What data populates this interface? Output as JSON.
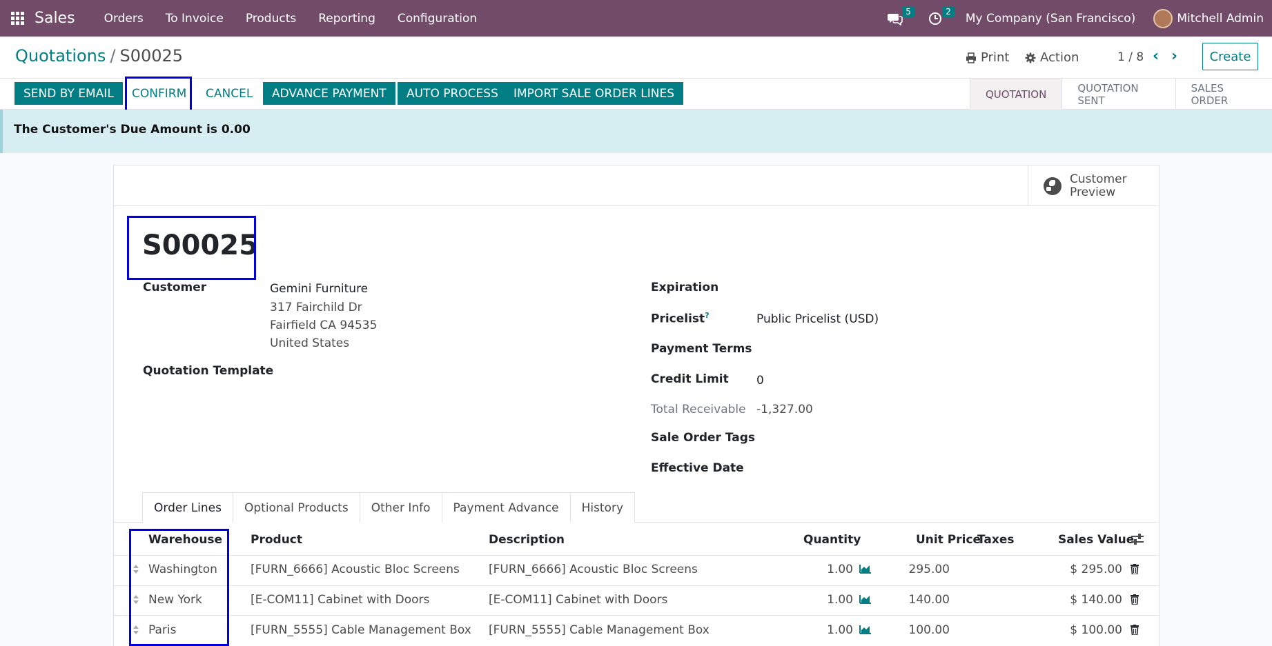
{
  "navbar": {
    "app_name": "Sales",
    "menu": [
      "Orders",
      "To Invoice",
      "Products",
      "Reporting",
      "Configuration"
    ],
    "messages_count": "5",
    "activities_count": "2",
    "company": "My Company (San Francisco)",
    "user": "Mitchell Admin",
    "color": "#714b67"
  },
  "control": {
    "breadcrumb_parent": "Quotations",
    "breadcrumb_sep": "/",
    "breadcrumb_current": "S00025",
    "print_label": "Print",
    "action_label": "Action",
    "pager": "1 / 8",
    "create_label": "Create"
  },
  "actions": {
    "send_email": "SEND BY EMAIL",
    "confirm": "CONFIRM",
    "cancel": "CANCEL",
    "advance_payment": "ADVANCE PAYMENT",
    "auto_process": "AUTO PROCESS",
    "import_lines": "IMPORT SALE ORDER LINES",
    "accent": "#017e84"
  },
  "statusbar": {
    "stages": [
      "QUOTATION",
      "QUOTATION SENT",
      "SALES ORDER"
    ],
    "active": "QUOTATION"
  },
  "alert": {
    "text": "The Customer's Due Amount is 0.00"
  },
  "sheet": {
    "preview_label_1": "Customer",
    "preview_label_2": "Preview",
    "name": "S00025",
    "customer_label": "Customer",
    "customer_name": "Gemini Furniture",
    "address_1": "317 Fairchild Dr",
    "address_2": "Fairfield CA 94535",
    "address_3": "United States",
    "template_label": "Quotation Template",
    "expiration_label": "Expiration",
    "pricelist_label": "Pricelist",
    "pricelist_help": "?",
    "pricelist_value": "Public Pricelist (USD)",
    "payment_terms_label": "Payment Terms",
    "credit_limit_label": "Credit Limit",
    "credit_limit_value": "0",
    "total_receivable_label": "Total Receivable",
    "total_receivable_value": "-1,327.00",
    "tags_label": "Sale Order Tags",
    "effective_date_label": "Effective Date"
  },
  "tabs": [
    "Order Lines",
    "Optional Products",
    "Other Info",
    "Payment Advance",
    "History"
  ],
  "table": {
    "headers": {
      "warehouse": "Warehouse",
      "product": "Product",
      "description": "Description",
      "quantity": "Quantity",
      "unit_price": "Unit Price",
      "taxes": "Taxes",
      "sales_value": "Sales Value"
    },
    "rows": [
      {
        "warehouse": "Washington",
        "product": "[FURN_6666] Acoustic Bloc Screens",
        "description": "[FURN_6666] Acoustic Bloc Screens",
        "quantity": "1.00",
        "unit_price": "295.00",
        "sales_value": "$ 295.00"
      },
      {
        "warehouse": "New York",
        "product": "[E-COM11] Cabinet with Doors",
        "description": "[E-COM11] Cabinet with Doors",
        "quantity": "1.00",
        "unit_price": "140.00",
        "sales_value": "$ 140.00"
      },
      {
        "warehouse": "Paris",
        "product": "[FURN_5555] Cable Management Box",
        "description": "[FURN_5555] Cable Management Box",
        "quantity": "1.00",
        "unit_price": "100.00",
        "sales_value": "$ 100.00"
      }
    ]
  }
}
